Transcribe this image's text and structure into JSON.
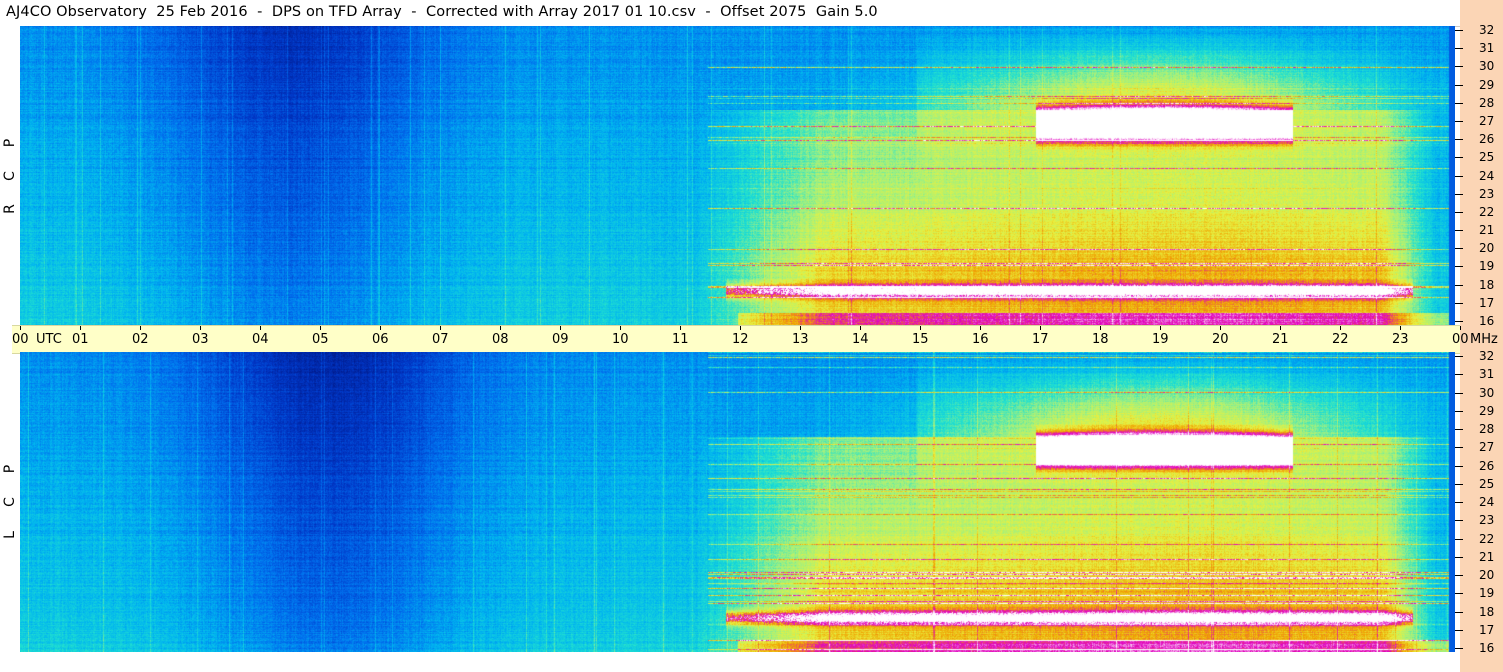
{
  "header": {
    "title": "AJ4CO Observatory  25 Feb 2016  -  DPS on TFD Array  -  Corrected with Array 2017 01 10.csv  -  Offset 2075  Gain 5.0"
  },
  "panels": [
    {
      "id": "rcp",
      "side_label": [
        "R",
        "C",
        "P"
      ]
    },
    {
      "id": "lcp",
      "side_label": [
        "L",
        "C",
        "P"
      ]
    }
  ],
  "colors": {
    "axis_background": "#ffffc8",
    "right_strip": "#fbd5b5"
  },
  "chart_data": {
    "type": "heatmap",
    "x_axis": {
      "unit": "UTC",
      "tick_labels": [
        "00",
        "01",
        "02",
        "03",
        "04",
        "05",
        "06",
        "07",
        "08",
        "09",
        "10",
        "11",
        "12",
        "13",
        "14",
        "15",
        "16",
        "17",
        "18",
        "19",
        "20",
        "21",
        "22",
        "23",
        "00"
      ],
      "range": [
        0,
        24
      ]
    },
    "y_axis": {
      "unit": "MHz",
      "tick_labels": [
        "32",
        "31",
        "30",
        "29",
        "28",
        "27",
        "26",
        "25",
        "24",
        "23",
        "22",
        "21",
        "20",
        "19",
        "18",
        "17",
        "16"
      ],
      "range": [
        16,
        32
      ]
    },
    "colormap": [
      "#001a8c",
      "#0038c8",
      "#0070ee",
      "#00b4f0",
      "#20e0d0",
      "#a0f080",
      "#e8f040",
      "#f0a000",
      "#e000c0",
      "#ffffff"
    ],
    "features": [
      {
        "description": "daytime ionospheric absorption trough",
        "utc_start": 2.5,
        "utc_end": 7.0
      },
      {
        "description": "evening noise / interference increase",
        "utc_start": 11.5,
        "utc_end": 23.5
      },
      {
        "description": "strong band at 27 MHz",
        "freq_mhz": 27,
        "utc_start": 17.0,
        "utc_end": 21.3
      }
    ]
  }
}
